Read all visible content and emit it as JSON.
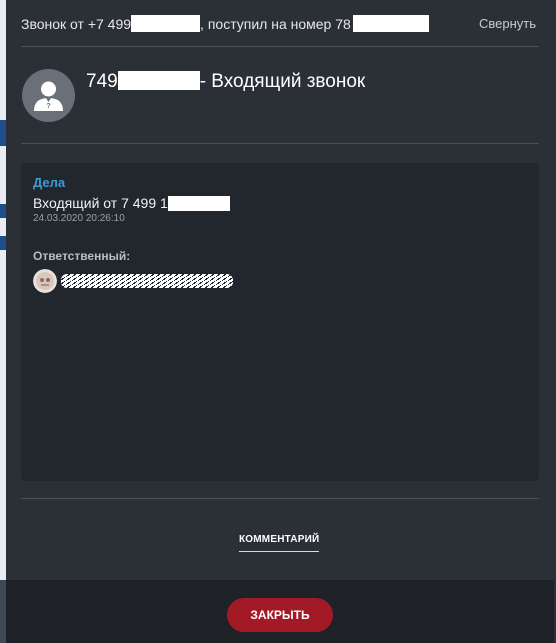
{
  "header": {
    "call_prefix": "Звонок от +7 499",
    "call_middle": ", поступил на номер 78",
    "collapse_label": "Свернуть"
  },
  "caller": {
    "number_prefix": "749",
    "title_suffix": "- Входящий звонок"
  },
  "deals": {
    "title": "Дела",
    "item_text": "Входящий от 7 499 1",
    "item_date": "24.03.2020 20:26:10",
    "responsible_label": "Ответственный:"
  },
  "comment_tab_label": "КОММЕНТАРИЙ",
  "close_button_label": "ЗАКРЫТЬ",
  "colors": {
    "accent_link": "#3a9bd6",
    "close_button": "#a31a27",
    "panel_bg": "#2b3037"
  }
}
